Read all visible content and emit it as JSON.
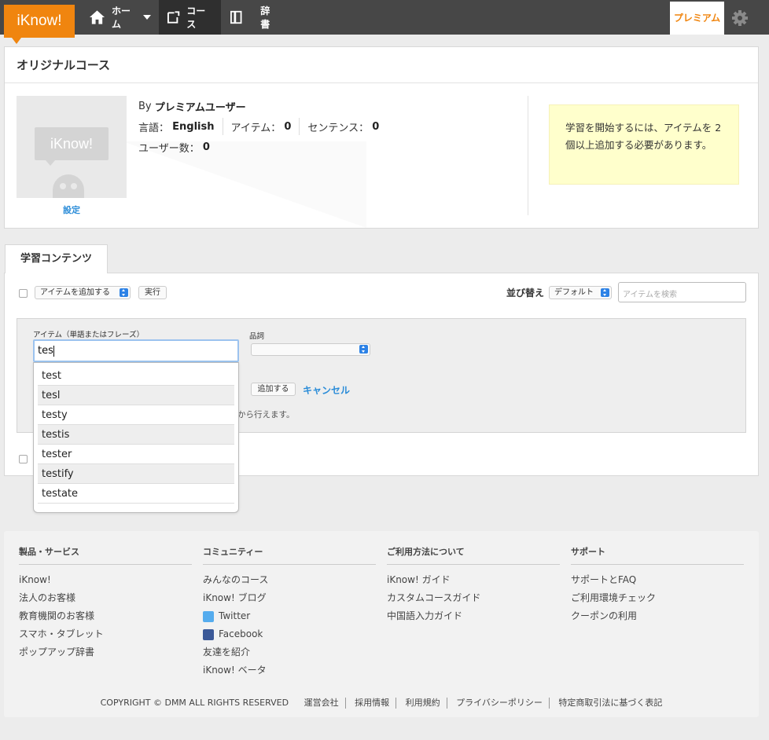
{
  "app": {
    "logo": "iKnow!"
  },
  "nav": {
    "home": "ホーム",
    "course": "コース",
    "dict": "辞書",
    "premium": "プレミアム"
  },
  "course": {
    "title": "オリジナルコース",
    "thumb_logo": "iKnow!",
    "settings": "設定",
    "by_prefix": "By",
    "author": "プレミアムユーザー",
    "language_label": "言語：",
    "language_value": "English",
    "items_label": "アイテム：",
    "items_value": "0",
    "sentences_label": "センテンス：",
    "sentences_value": "0",
    "users_label": "ユーザー数：",
    "users_value": "0",
    "notice": "学習を開始するには、アイテムを 2 個以上追加する必要があります。"
  },
  "content": {
    "tab": "学習コンテンツ",
    "action_select": "アイテムを追加する",
    "run_button": "実行",
    "sort_label": "並び替え",
    "sort_select": "デフォルト",
    "search_placeholder": "アイテムを検索",
    "item_label": "アイテム（単語またはフレーズ）",
    "item_value": "tes",
    "pos_label": "品詞",
    "add_button": "追加する",
    "cancel": "キャンセル",
    "hint": "から行えます。"
  },
  "autocomplete": [
    "test",
    "tesl",
    "testy",
    "testis",
    "tester",
    "testify",
    "testate"
  ],
  "footer": {
    "columns": [
      {
        "title": "製品・サービス",
        "links": [
          "iKnow!",
          "法人のお客様",
          "教育機関のお客様",
          "スマホ・タブレット",
          "ポップアップ辞書"
        ]
      },
      {
        "title": "コミュニティー",
        "links": [
          "みんなのコース",
          "iKnow! ブログ",
          "Twitter",
          "Facebook",
          "友達を紹介",
          "iKnow! ベータ"
        ]
      },
      {
        "title": "ご利用方法について",
        "links": [
          "iKnow! ガイド",
          "カスタムコースガイド",
          "中国語入力ガイド"
        ]
      },
      {
        "title": "サポート",
        "links": [
          "サポートとFAQ",
          "ご利用環境チェック",
          "クーポンの利用"
        ]
      }
    ],
    "copyright": "COPYRIGHT © DMM ALL RIGHTS RESERVED",
    "legal": [
      "運営会社",
      "採用情報",
      "利用規約",
      "プライバシーポリシー",
      "特定商取引法に基づく表記"
    ]
  },
  "colors": {
    "brand": "#f0850f",
    "link": "#2a8cd8",
    "twitter": "#55acee",
    "facebook": "#3b5998"
  }
}
